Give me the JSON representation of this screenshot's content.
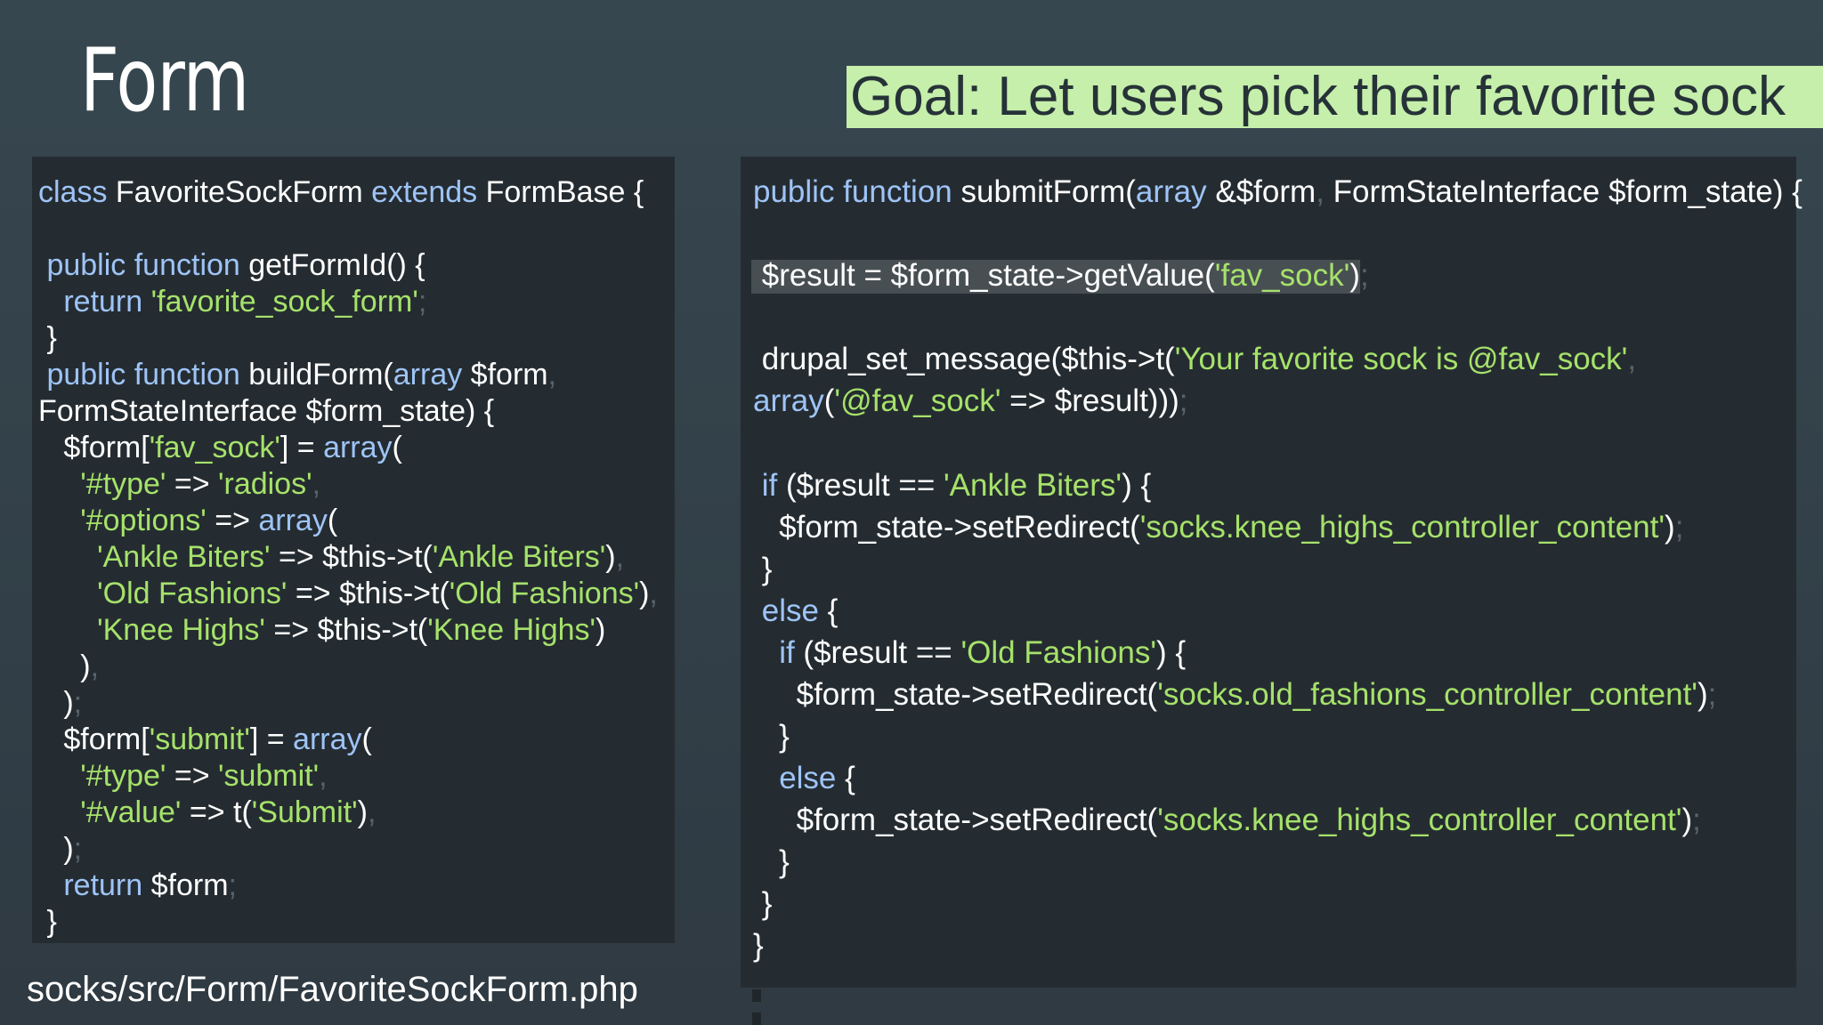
{
  "slide": {
    "title": "Form",
    "goal": "Goal: Let users pick their favorite sock",
    "file_path": "socks/src/Form/FavoriteSockForm.php"
  },
  "colors": {
    "background": "#37474f",
    "code_background": "#252c31",
    "keyword": "#9ec4f7",
    "string": "#a6e26b",
    "plain": "#ffffff",
    "goal_banner": "#c5efaa"
  },
  "left_code": [
    [
      [
        "class",
        "kw"
      ],
      [
        " FavoriteSockForm ",
        "pl"
      ],
      [
        "extends",
        "kw"
      ],
      [
        " FormBase {",
        "pl"
      ]
    ],
    [],
    [
      [
        " ",
        "pl"
      ],
      [
        "public function",
        "kw"
      ],
      [
        " getFormId() {",
        "pl"
      ]
    ],
    [
      [
        "   ",
        "pl"
      ],
      [
        "return",
        "kw"
      ],
      [
        " ",
        "pl"
      ],
      [
        "'favorite_sock_form'",
        "str"
      ],
      [
        ";",
        "pn"
      ]
    ],
    [
      [
        " }",
        "pl"
      ]
    ],
    [
      [
        " ",
        "pl"
      ],
      [
        "public function",
        "kw"
      ],
      [
        " buildForm(",
        "pl"
      ],
      [
        "array",
        "kw"
      ],
      [
        " $form",
        "pl"
      ],
      [
        ",",
        "pn"
      ]
    ],
    [
      [
        "FormStateInterface $form_state) {",
        "pl"
      ]
    ],
    [
      [
        "   $form[",
        "pl"
      ],
      [
        "'fav_sock'",
        "str"
      ],
      [
        "] = ",
        "pl"
      ],
      [
        "array",
        "kw"
      ],
      [
        "(",
        "pl"
      ]
    ],
    [
      [
        "     ",
        "pl"
      ],
      [
        "'#type'",
        "str"
      ],
      [
        " => ",
        "pl"
      ],
      [
        "'radios'",
        "str"
      ],
      [
        ",",
        "pn"
      ]
    ],
    [
      [
        "     ",
        "pl"
      ],
      [
        "'#options'",
        "str"
      ],
      [
        " => ",
        "pl"
      ],
      [
        "array",
        "kw"
      ],
      [
        "(",
        "pl"
      ]
    ],
    [
      [
        "       ",
        "pl"
      ],
      [
        "'Ankle Biters'",
        "str"
      ],
      [
        " => $this->t(",
        "pl"
      ],
      [
        "'Ankle Biters'",
        "str"
      ],
      [
        ")",
        "pl"
      ],
      [
        ",",
        "pn"
      ]
    ],
    [
      [
        "       ",
        "pl"
      ],
      [
        "'Old Fashions'",
        "str"
      ],
      [
        " => $this->t(",
        "pl"
      ],
      [
        "'Old Fashions'",
        "str"
      ],
      [
        ")",
        "pl"
      ],
      [
        ",",
        "pn"
      ]
    ],
    [
      [
        "       ",
        "pl"
      ],
      [
        "'Knee Highs'",
        "str"
      ],
      [
        " => $this->t(",
        "pl"
      ],
      [
        "'Knee Highs'",
        "str"
      ],
      [
        ")",
        "pl"
      ]
    ],
    [
      [
        "     )",
        "pl"
      ],
      [
        ",",
        "pn"
      ]
    ],
    [
      [
        "   )",
        "pl"
      ],
      [
        ";",
        "pn"
      ]
    ],
    [
      [
        "   $form[",
        "pl"
      ],
      [
        "'submit'",
        "str"
      ],
      [
        "] = ",
        "pl"
      ],
      [
        "array",
        "kw"
      ],
      [
        "(",
        "pl"
      ]
    ],
    [
      [
        "     ",
        "pl"
      ],
      [
        "'#type'",
        "str"
      ],
      [
        " => ",
        "pl"
      ],
      [
        "'submit'",
        "str"
      ],
      [
        ",",
        "pn"
      ]
    ],
    [
      [
        "     ",
        "pl"
      ],
      [
        "'#value'",
        "str"
      ],
      [
        " => t(",
        "pl"
      ],
      [
        "'Submit'",
        "str"
      ],
      [
        ")",
        "pl"
      ],
      [
        ",",
        "pn"
      ]
    ],
    [
      [
        "   )",
        "pl"
      ],
      [
        ";",
        "pn"
      ]
    ],
    [
      [
        "   ",
        "pl"
      ],
      [
        "return",
        "kw"
      ],
      [
        " $form",
        "pl"
      ],
      [
        ";",
        "pn"
      ]
    ],
    [
      [
        " }",
        "pl"
      ]
    ]
  ],
  "right_code": [
    [
      [
        "public function",
        "kw"
      ],
      [
        " submitForm(",
        "pl"
      ],
      [
        "array",
        "kw"
      ],
      [
        " &$form",
        "pl"
      ],
      [
        ",",
        "pn"
      ],
      [
        " FormStateInterface $form_state) {",
        "pl"
      ]
    ],
    [],
    [
      [
        " $result = $form_state->getValue(",
        "pl"
      ],
      [
        "'fav_sock'",
        "str"
      ],
      [
        ")",
        "pl"
      ],
      [
        ";",
        "pn"
      ]
    ],
    [],
    [
      [
        " drupal_set_message($this->t(",
        "pl"
      ],
      [
        "'Your favorite sock is @fav_sock'",
        "str"
      ],
      [
        ",",
        "pn"
      ]
    ],
    [
      [
        "array",
        "kw"
      ],
      [
        "(",
        "pl"
      ],
      [
        "'@fav_sock'",
        "str"
      ],
      [
        " => $result)))",
        "pl"
      ],
      [
        ";",
        "pn"
      ]
    ],
    [],
    [
      [
        " ",
        "pl"
      ],
      [
        "if",
        "kw"
      ],
      [
        " ($result == ",
        "pl"
      ],
      [
        "'Ankle Biters'",
        "str"
      ],
      [
        ") {",
        "pl"
      ]
    ],
    [
      [
        "   $form_state->setRedirect(",
        "pl"
      ],
      [
        "'socks.knee_highs_controller_content'",
        "str"
      ],
      [
        ")",
        "pl"
      ],
      [
        ";",
        "pn"
      ]
    ],
    [
      [
        " }",
        "pl"
      ]
    ],
    [
      [
        " ",
        "pl"
      ],
      [
        "else",
        "kw"
      ],
      [
        " {",
        "pl"
      ]
    ],
    [
      [
        "   ",
        "pl"
      ],
      [
        "if",
        "kw"
      ],
      [
        " ($result == ",
        "pl"
      ],
      [
        "'Old Fashions'",
        "str"
      ],
      [
        ") {",
        "pl"
      ]
    ],
    [
      [
        "     $form_state->setRedirect(",
        "pl"
      ],
      [
        "'socks.old_fashions_controller_content'",
        "str"
      ],
      [
        ")",
        "pl"
      ],
      [
        ";",
        "pn"
      ]
    ],
    [
      [
        "   }",
        "pl"
      ]
    ],
    [
      [
        "   ",
        "pl"
      ],
      [
        "else",
        "kw"
      ],
      [
        " {",
        "pl"
      ]
    ],
    [
      [
        "     $form_state->setRedirect(",
        "pl"
      ],
      [
        "'socks.knee_highs_controller_content'",
        "str"
      ],
      [
        ")",
        "pl"
      ],
      [
        ";",
        "pn"
      ]
    ],
    [
      [
        "   }",
        "pl"
      ]
    ],
    [
      [
        " }",
        "pl"
      ]
    ],
    [
      [
        "}",
        "pl"
      ]
    ]
  ]
}
